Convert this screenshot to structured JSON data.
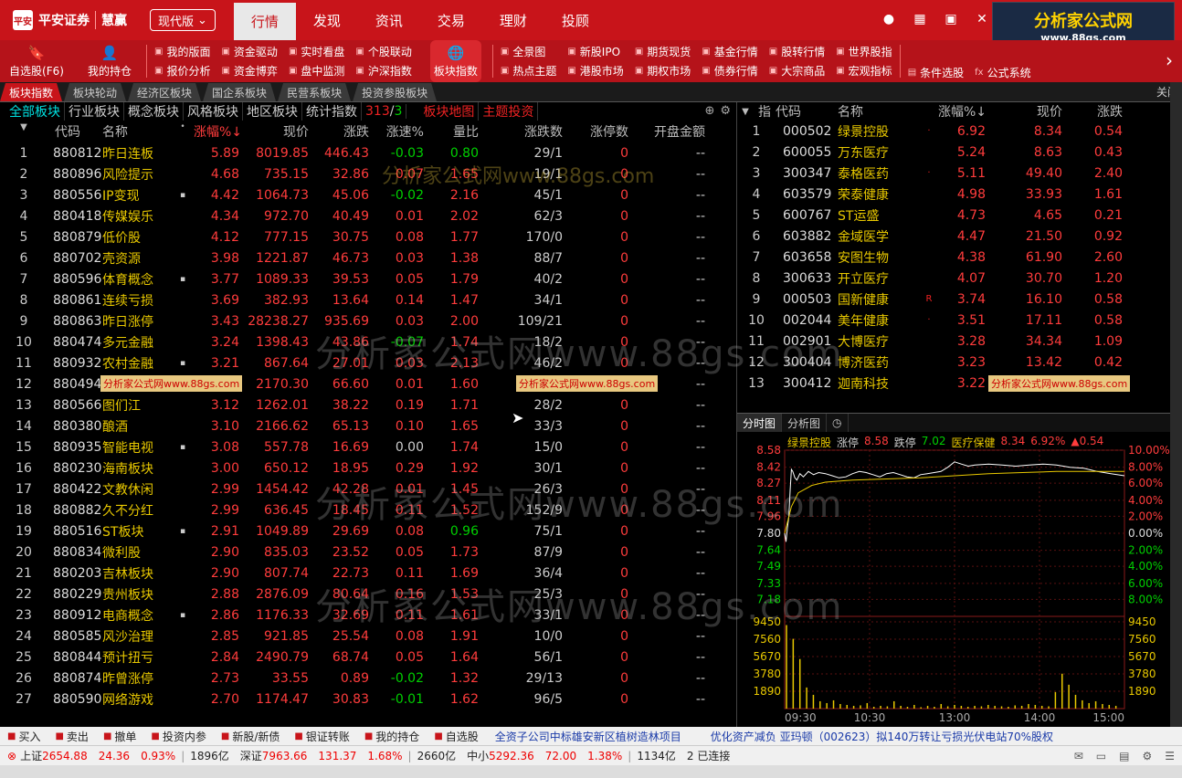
{
  "app": {
    "logo_cn": "平安证券",
    "logo_brand": "慧赢",
    "version_label": "现代版"
  },
  "nav_tabs": [
    "行情",
    "发现",
    "资讯",
    "交易",
    "理财",
    "投顾"
  ],
  "ad_logo": {
    "title": "分析家公式网",
    "url": "www.88gs.com"
  },
  "toolbar": {
    "left_big": [
      {
        "label": "自选股(F6)",
        "icon": "bookmark-icon"
      },
      {
        "label": "我的持仓",
        "icon": "user-icon"
      }
    ],
    "group1": [
      "我的版面",
      "报价分析",
      "资金驱动",
      "资金博弈",
      "实时看盘",
      "盘中监测",
      "个股联动",
      "沪深指数"
    ],
    "active": "板块指数",
    "group2": [
      "全景图",
      "热点主题",
      "新股IPO",
      "港股市场",
      "期货现货",
      "期权市场",
      "基金行情",
      "债券行情",
      "股转行情",
      "大宗商品",
      "世界股指",
      "宏观指标"
    ],
    "right_big": [
      {
        "label": "条件选股",
        "icon": "filter-icon"
      },
      {
        "label": "公式系统",
        "icon": "fx-icon"
      }
    ]
  },
  "sheet_tabs": [
    "板块指数",
    "板块轮动",
    "经济区板块",
    "国企系板块",
    "民营系板块",
    "投资参股板块"
  ],
  "close_all": "关闭",
  "sub_tabs": [
    "全部板块",
    "行业板块",
    "概念板块",
    "风格板块",
    "地区板块",
    "统计指数"
  ],
  "sub_count": {
    "a": "313",
    "b": "3"
  },
  "sub_links": [
    "板块地图",
    "主题投资"
  ],
  "left_columns": [
    "代码",
    "名称",
    "•",
    "涨幅%↓",
    "现价",
    "涨跌",
    "涨速%",
    "量比",
    "涨跌数",
    "涨停数",
    "开盘金额"
  ],
  "left_rows": [
    [
      "1",
      "880812",
      "昨日连板",
      "",
      "5.89",
      "8019.85",
      "446.43",
      "-0.03",
      "0.80",
      "29/1",
      "0",
      "--"
    ],
    [
      "2",
      "880896",
      "风险提示",
      "",
      "4.68",
      "735.15",
      "32.86",
      "0.07",
      "1.65",
      "19/1",
      "0",
      "--"
    ],
    [
      "3",
      "880556",
      "IP变现",
      "▪",
      "4.42",
      "1064.73",
      "45.06",
      "-0.02",
      "2.16",
      "45/1",
      "0",
      "--"
    ],
    [
      "4",
      "880418",
      "传媒娱乐",
      "",
      "4.34",
      "972.70",
      "40.49",
      "0.01",
      "2.02",
      "62/3",
      "0",
      "--"
    ],
    [
      "5",
      "880879",
      "低价股",
      "",
      "4.12",
      "777.15",
      "30.75",
      "0.08",
      "1.77",
      "170/0",
      "0",
      "--"
    ],
    [
      "6",
      "880702",
      "壳资源",
      "",
      "3.98",
      "1221.87",
      "46.73",
      "0.03",
      "1.38",
      "88/7",
      "0",
      "--"
    ],
    [
      "7",
      "880596",
      "体育概念",
      "▪",
      "3.77",
      "1089.33",
      "39.53",
      "0.05",
      "1.79",
      "40/2",
      "0",
      "--"
    ],
    [
      "8",
      "880861",
      "连续亏损",
      "",
      "3.69",
      "382.93",
      "13.64",
      "0.14",
      "1.47",
      "34/1",
      "0",
      "--"
    ],
    [
      "9",
      "880863",
      "昨日涨停",
      "",
      "3.43",
      "28238.27",
      "935.69",
      "0.03",
      "2.00",
      "109/21",
      "0",
      "--"
    ],
    [
      "10",
      "880474",
      "多元金融",
      "",
      "3.24",
      "1398.43",
      "43.86",
      "-0.07",
      "1.74",
      "18/2",
      "0",
      "--"
    ],
    [
      "11",
      "880932",
      "农村金融",
      "▪",
      "3.21",
      "867.64",
      "27.01",
      "0.03",
      "2.13",
      "46/2",
      "0",
      "--"
    ],
    [
      "12",
      "880494",
      "互联网",
      "",
      "3.17",
      "2170.30",
      "66.60",
      "0.01",
      "1.60",
      "",
      "0",
      "--"
    ],
    [
      "13",
      "880566",
      "图们江",
      "",
      "3.12",
      "1262.01",
      "38.22",
      "0.19",
      "1.71",
      "28/2",
      "0",
      "--"
    ],
    [
      "14",
      "880380",
      "酿酒",
      "",
      "3.10",
      "2166.62",
      "65.13",
      "0.10",
      "1.65",
      "33/3",
      "0",
      "--"
    ],
    [
      "15",
      "880935",
      "智能电视",
      "▪",
      "3.08",
      "557.78",
      "16.69",
      "0.00",
      "1.74",
      "15/0",
      "0",
      "--"
    ],
    [
      "16",
      "880230",
      "海南板块",
      "",
      "3.00",
      "650.12",
      "18.95",
      "0.29",
      "1.92",
      "30/1",
      "0",
      "--"
    ],
    [
      "17",
      "880422",
      "文教休闲",
      "",
      "2.99",
      "1454.42",
      "42.28",
      "0.01",
      "1.45",
      "26/3",
      "0",
      "--"
    ],
    [
      "18",
      "880882",
      "久不分红",
      "",
      "2.99",
      "636.45",
      "18.45",
      "0.11",
      "1.52",
      "152/9",
      "0",
      "--"
    ],
    [
      "19",
      "880516",
      "ST板块",
      "▪",
      "2.91",
      "1049.89",
      "29.69",
      "0.08",
      "0.96",
      "75/1",
      "0",
      "--"
    ],
    [
      "20",
      "880834",
      "微利股",
      "",
      "2.90",
      "835.03",
      "23.52",
      "0.05",
      "1.73",
      "87/9",
      "0",
      "--"
    ],
    [
      "21",
      "880203",
      "吉林板块",
      "",
      "2.90",
      "807.74",
      "22.73",
      "0.11",
      "1.69",
      "36/4",
      "0",
      "--"
    ],
    [
      "22",
      "880229",
      "贵州板块",
      "",
      "2.88",
      "2876.09",
      "80.64",
      "0.16",
      "1.53",
      "25/3",
      "0",
      "--"
    ],
    [
      "23",
      "880912",
      "电商概念",
      "▪",
      "2.86",
      "1176.33",
      "32.69",
      "0.11",
      "1.61",
      "33/1",
      "0",
      "--"
    ],
    [
      "24",
      "880585",
      "风沙治理",
      "",
      "2.85",
      "921.85",
      "25.54",
      "0.08",
      "1.91",
      "10/0",
      "0",
      "--"
    ],
    [
      "25",
      "880844",
      "预计扭亏",
      "",
      "2.84",
      "2490.79",
      "68.74",
      "0.05",
      "1.64",
      "56/1",
      "0",
      "--"
    ],
    [
      "26",
      "880874",
      "昨曾涨停",
      "",
      "2.73",
      "33.55",
      "0.89",
      "-0.02",
      "1.32",
      "29/13",
      "0",
      "--"
    ],
    [
      "27",
      "880590",
      "网络游戏",
      "",
      "2.70",
      "1174.47",
      "30.83",
      "-0.01",
      "1.62",
      "96/5",
      "0",
      "--"
    ]
  ],
  "right_columns": [
    "指",
    "代码",
    "名称",
    "涨幅%↓",
    "现价",
    "涨跌"
  ],
  "right_rows": [
    [
      "1",
      "000502",
      "绿景控股",
      "·",
      "6.92",
      "8.34",
      "0.54"
    ],
    [
      "2",
      "600055",
      "万东医疗",
      "",
      "5.24",
      "8.63",
      "0.43"
    ],
    [
      "3",
      "300347",
      "泰格医药",
      "·",
      "5.11",
      "49.40",
      "2.40"
    ],
    [
      "4",
      "603579",
      "荣泰健康",
      "",
      "4.98",
      "33.93",
      "1.61"
    ],
    [
      "5",
      "600767",
      "ST运盛",
      "",
      "4.73",
      "4.65",
      "0.21"
    ],
    [
      "6",
      "603882",
      "金域医学",
      "",
      "4.47",
      "21.50",
      "0.92"
    ],
    [
      "7",
      "603658",
      "安图生物",
      "",
      "4.38",
      "61.90",
      "2.60"
    ],
    [
      "8",
      "300633",
      "开立医疗",
      "",
      "4.07",
      "30.70",
      "1.20"
    ],
    [
      "9",
      "000503",
      "国新健康",
      "R",
      "3.74",
      "16.10",
      "0.58"
    ],
    [
      "10",
      "002044",
      "美年健康",
      "·",
      "3.51",
      "17.11",
      "0.58"
    ],
    [
      "11",
      "002901",
      "大博医疗",
      "",
      "3.28",
      "34.34",
      "1.09"
    ],
    [
      "12",
      "300404",
      "博济医药",
      "",
      "3.23",
      "13.42",
      "0.42"
    ],
    [
      "13",
      "300412",
      "迦南科技",
      "",
      "3.22",
      "",
      "0.24"
    ]
  ],
  "chart_tabs": [
    "分时图",
    "分析图"
  ],
  "chart_info": {
    "name": "绿景控股",
    "lim_up_label": "涨停",
    "lim_up": "8.58",
    "lim_dn_label": "跌停",
    "lim_dn": "7.02",
    "sector": "医疗保健",
    "price": "8.34",
    "pct": "6.92%",
    "chg": "▲0.54"
  },
  "chart_data": {
    "type": "line",
    "title": "",
    "price_ticks_left": [
      "8.58",
      "8.42",
      "8.27",
      "8.11",
      "7.96",
      "7.80",
      "7.64",
      "7.49",
      "7.33",
      "7.18"
    ],
    "pct_ticks_right": [
      "10.00%",
      "8.00%",
      "6.00%",
      "4.00%",
      "2.00%",
      "0.00%",
      "2.00%",
      "4.00%",
      "6.00%",
      "8.00%"
    ],
    "volume_ticks": [
      "9450",
      "7560",
      "5670",
      "3780",
      "1890"
    ],
    "time_ticks": [
      "09:30",
      "10:30",
      "13:00",
      "14:00",
      "15:00"
    ],
    "ylim": [
      7.02,
      8.58
    ],
    "base_price": 7.8,
    "series": [
      {
        "x": [
          0,
          4,
          8,
          12,
          16,
          20,
          24,
          30,
          36,
          45,
          55,
          70,
          85,
          100,
          120,
          140,
          160,
          180,
          200,
          220,
          240,
          260,
          280,
          300,
          320,
          340,
          360,
          380,
          400,
          420,
          440,
          460,
          480,
          500,
          520,
          540,
          560,
          600,
          640,
          680,
          720,
          760,
          800,
          840,
          880,
          920,
          960,
          1000
        ],
        "values": [
          7.8,
          7.72,
          7.85,
          7.95,
          8.2,
          8.4,
          8.38,
          8.32,
          8.3,
          8.36,
          8.33,
          8.38,
          8.35,
          8.37,
          8.36,
          8.34,
          8.32,
          8.33,
          8.36,
          8.38,
          8.37,
          8.35,
          8.33,
          8.36,
          8.37,
          8.35,
          8.33,
          8.32,
          8.35,
          8.36,
          8.37,
          8.38,
          8.42,
          8.47,
          8.45,
          8.43,
          8.44,
          8.45,
          8.44,
          8.43,
          8.44,
          8.45,
          8.44,
          8.42,
          8.41,
          8.38,
          8.36,
          8.34
        ]
      },
      {
        "x": [
          0,
          20,
          40,
          80,
          120,
          200,
          300,
          400,
          500,
          600,
          700,
          800,
          900,
          1000
        ],
        "values": [
          7.8,
          8.05,
          8.18,
          8.25,
          8.28,
          8.3,
          8.31,
          8.32,
          8.34,
          8.36,
          8.37,
          8.38,
          8.38,
          8.38
        ]
      }
    ],
    "volume": [
      9100,
      7600,
      5400,
      2300,
      1500,
      800,
      600,
      900,
      500,
      400,
      300,
      350,
      600,
      200,
      300,
      250,
      800,
      300,
      200,
      400,
      150,
      300,
      200,
      500,
      250,
      400,
      300,
      200,
      300,
      250,
      400,
      300,
      250,
      200,
      350,
      300,
      500,
      400,
      300,
      250,
      1800,
      3800,
      2600,
      1500,
      900,
      600,
      800,
      500,
      400,
      300
    ]
  },
  "bottom_bar": [
    "买入",
    "卖出",
    "撤单",
    "投资内参",
    "新股/新债",
    "银证转账",
    "我的持仓",
    "自选股"
  ],
  "ticker": [
    "全资子公司中标雄安新区植树造林项目",
    "优化资产减负 亚玛顿（002623）拟140万转让亏损光伏电站70%股权"
  ],
  "status": {
    "sh_label": "上证",
    "sh_val": "2654.88",
    "sh_chg": "24.36",
    "sh_pct": "0.93%",
    "sh_amt": "1896亿",
    "sz_label": "深证",
    "sz_val": "7963.66",
    "sz_chg": "131.37",
    "sz_pct": "1.68%",
    "sz_amt": "2660亿",
    "zx_label": "中小",
    "zx_val": "5292.36",
    "zx_chg": "72.00",
    "zx_pct": "1.38%",
    "zx_amt": "1134亿",
    "conn": "已连接"
  },
  "watermark": "分析家公式网www.88gs.com"
}
